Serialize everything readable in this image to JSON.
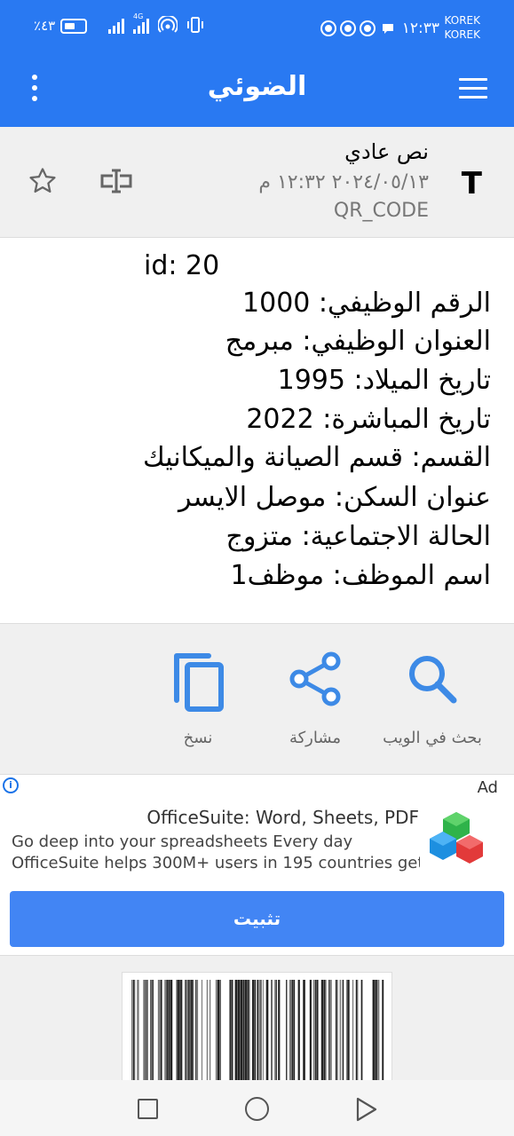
{
  "status_bar": {
    "battery": "٪٤٣",
    "network": "4G",
    "time": "١٢:٣٣",
    "carrier_1": "KOREK",
    "carrier_2": "KOREK"
  },
  "app_bar": {
    "title": "الضوئي",
    "menu_icon": "hamburger-icon",
    "more_icon": "more-vert-icon"
  },
  "record": {
    "type_label": "نص عادي",
    "type_icon": "T",
    "datetime": "٢٠٢٤/٠٥/١٣ ١٢:٣٢ م",
    "format": "QR_CODE"
  },
  "content_lines": [
    "id: 20",
    "الرقم الوظيفي: 1000",
    "العنوان الوظيفي: مبرمج",
    "تاريخ الميلاد: 1995",
    "تاريخ المباشرة: 2022",
    "القسم: قسم الصيانة والميكانيك",
    "عنوان السكن: موصل الايسر",
    "الحالة الاجتماعية: متزوج",
    "اسم الموظف: موظف1"
  ],
  "actions": {
    "search_web": "بحث في الويب",
    "share": "مشاركة",
    "copy": "نسخ"
  },
  "ad": {
    "tag": "Ad",
    "info_glyph": "i",
    "title": "OfficeSuite: Word, Sheets, PDF",
    "desc_1": "Go deep into your spreadsheets Every day",
    "desc_2": "OfficeSuite helps 300M+ users in 195 countries get ...",
    "install": "تثبيت"
  },
  "colors": {
    "primary": "#2979f2",
    "icon_blue": "#3d8ae6",
    "install_button": "#4285f4"
  }
}
